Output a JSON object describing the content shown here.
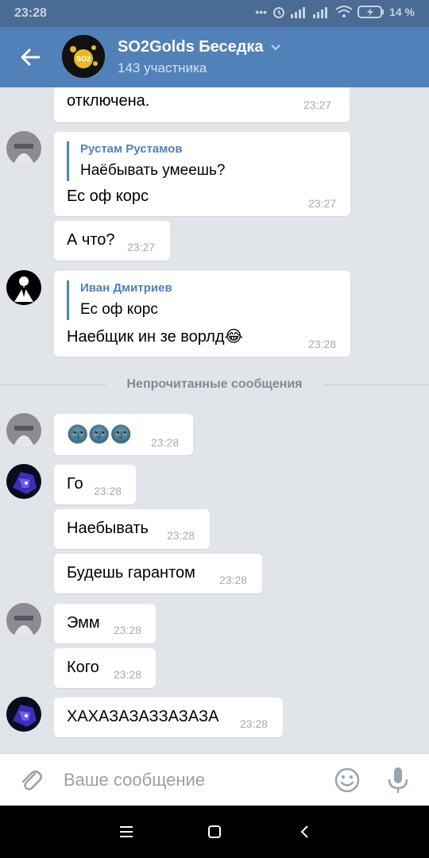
{
  "status_bar": {
    "time": "23:28",
    "battery": "14 %"
  },
  "header": {
    "title": "SO2Golds Беседка",
    "subtitle": "143 участника",
    "avatar_label": "SO2"
  },
  "messages": [
    {
      "text": "отключена.",
      "time": "23:27"
    },
    {
      "quote_author": "Рустам Рустамов",
      "quote_text": "Наёбывать умеешь?",
      "text": "Ес оф корс",
      "time": "23:27"
    },
    {
      "text": "А что?",
      "time": "23:27"
    },
    {
      "quote_author": "Иван Дмитриев",
      "quote_text": "Ес оф корс",
      "text": "Наебщик ин зе ворлд😂",
      "time": "23:28"
    },
    {
      "text": "🌚🌚🌚",
      "time": "23:28"
    },
    {
      "text": "Го",
      "time": "23:28"
    },
    {
      "text": "Наебывать",
      "time": "23:28"
    },
    {
      "text": "Будешь гарантом",
      "time": "23:28"
    },
    {
      "text": "Эмм",
      "time": "23:28"
    },
    {
      "text": "Кого",
      "time": "23:28"
    },
    {
      "text": "ХАХАЗАЗАЗЗАЗАЗА",
      "time": "23:28"
    }
  ],
  "divider": "Непрочитанные сообщения",
  "composer": {
    "placeholder": "Ваше сообщение"
  },
  "colors": {
    "header": "#5181b8",
    "status_bar": "#4a6b93",
    "background": "#e1e5ea",
    "accent": "#5181b8"
  }
}
